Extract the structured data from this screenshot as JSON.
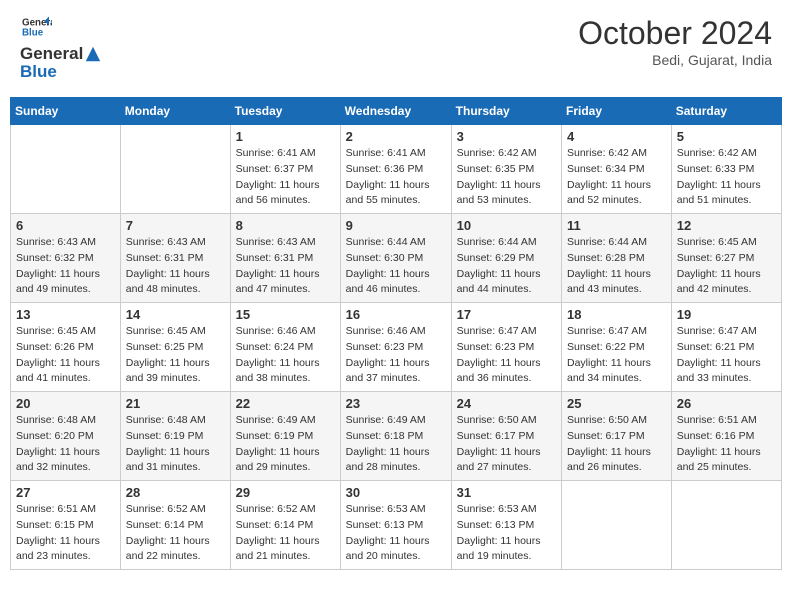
{
  "header": {
    "logo_text_general": "General",
    "logo_text_blue": "Blue",
    "month": "October 2024",
    "location": "Bedi, Gujarat, India"
  },
  "days_of_week": [
    "Sunday",
    "Monday",
    "Tuesday",
    "Wednesday",
    "Thursday",
    "Friday",
    "Saturday"
  ],
  "weeks": [
    [
      {
        "day": "",
        "info": ""
      },
      {
        "day": "",
        "info": ""
      },
      {
        "day": "1",
        "info": "Sunrise: 6:41 AM\nSunset: 6:37 PM\nDaylight: 11 hours and 56 minutes."
      },
      {
        "day": "2",
        "info": "Sunrise: 6:41 AM\nSunset: 6:36 PM\nDaylight: 11 hours and 55 minutes."
      },
      {
        "day": "3",
        "info": "Sunrise: 6:42 AM\nSunset: 6:35 PM\nDaylight: 11 hours and 53 minutes."
      },
      {
        "day": "4",
        "info": "Sunrise: 6:42 AM\nSunset: 6:34 PM\nDaylight: 11 hours and 52 minutes."
      },
      {
        "day": "5",
        "info": "Sunrise: 6:42 AM\nSunset: 6:33 PM\nDaylight: 11 hours and 51 minutes."
      }
    ],
    [
      {
        "day": "6",
        "info": "Sunrise: 6:43 AM\nSunset: 6:32 PM\nDaylight: 11 hours and 49 minutes."
      },
      {
        "day": "7",
        "info": "Sunrise: 6:43 AM\nSunset: 6:31 PM\nDaylight: 11 hours and 48 minutes."
      },
      {
        "day": "8",
        "info": "Sunrise: 6:43 AM\nSunset: 6:31 PM\nDaylight: 11 hours and 47 minutes."
      },
      {
        "day": "9",
        "info": "Sunrise: 6:44 AM\nSunset: 6:30 PM\nDaylight: 11 hours and 46 minutes."
      },
      {
        "day": "10",
        "info": "Sunrise: 6:44 AM\nSunset: 6:29 PM\nDaylight: 11 hours and 44 minutes."
      },
      {
        "day": "11",
        "info": "Sunrise: 6:44 AM\nSunset: 6:28 PM\nDaylight: 11 hours and 43 minutes."
      },
      {
        "day": "12",
        "info": "Sunrise: 6:45 AM\nSunset: 6:27 PM\nDaylight: 11 hours and 42 minutes."
      }
    ],
    [
      {
        "day": "13",
        "info": "Sunrise: 6:45 AM\nSunset: 6:26 PM\nDaylight: 11 hours and 41 minutes."
      },
      {
        "day": "14",
        "info": "Sunrise: 6:45 AM\nSunset: 6:25 PM\nDaylight: 11 hours and 39 minutes."
      },
      {
        "day": "15",
        "info": "Sunrise: 6:46 AM\nSunset: 6:24 PM\nDaylight: 11 hours and 38 minutes."
      },
      {
        "day": "16",
        "info": "Sunrise: 6:46 AM\nSunset: 6:23 PM\nDaylight: 11 hours and 37 minutes."
      },
      {
        "day": "17",
        "info": "Sunrise: 6:47 AM\nSunset: 6:23 PM\nDaylight: 11 hours and 36 minutes."
      },
      {
        "day": "18",
        "info": "Sunrise: 6:47 AM\nSunset: 6:22 PM\nDaylight: 11 hours and 34 minutes."
      },
      {
        "day": "19",
        "info": "Sunrise: 6:47 AM\nSunset: 6:21 PM\nDaylight: 11 hours and 33 minutes."
      }
    ],
    [
      {
        "day": "20",
        "info": "Sunrise: 6:48 AM\nSunset: 6:20 PM\nDaylight: 11 hours and 32 minutes."
      },
      {
        "day": "21",
        "info": "Sunrise: 6:48 AM\nSunset: 6:19 PM\nDaylight: 11 hours and 31 minutes."
      },
      {
        "day": "22",
        "info": "Sunrise: 6:49 AM\nSunset: 6:19 PM\nDaylight: 11 hours and 29 minutes."
      },
      {
        "day": "23",
        "info": "Sunrise: 6:49 AM\nSunset: 6:18 PM\nDaylight: 11 hours and 28 minutes."
      },
      {
        "day": "24",
        "info": "Sunrise: 6:50 AM\nSunset: 6:17 PM\nDaylight: 11 hours and 27 minutes."
      },
      {
        "day": "25",
        "info": "Sunrise: 6:50 AM\nSunset: 6:17 PM\nDaylight: 11 hours and 26 minutes."
      },
      {
        "day": "26",
        "info": "Sunrise: 6:51 AM\nSunset: 6:16 PM\nDaylight: 11 hours and 25 minutes."
      }
    ],
    [
      {
        "day": "27",
        "info": "Sunrise: 6:51 AM\nSunset: 6:15 PM\nDaylight: 11 hours and 23 minutes."
      },
      {
        "day": "28",
        "info": "Sunrise: 6:52 AM\nSunset: 6:14 PM\nDaylight: 11 hours and 22 minutes."
      },
      {
        "day": "29",
        "info": "Sunrise: 6:52 AM\nSunset: 6:14 PM\nDaylight: 11 hours and 21 minutes."
      },
      {
        "day": "30",
        "info": "Sunrise: 6:53 AM\nSunset: 6:13 PM\nDaylight: 11 hours and 20 minutes."
      },
      {
        "day": "31",
        "info": "Sunrise: 6:53 AM\nSunset: 6:13 PM\nDaylight: 11 hours and 19 minutes."
      },
      {
        "day": "",
        "info": ""
      },
      {
        "day": "",
        "info": ""
      }
    ]
  ]
}
